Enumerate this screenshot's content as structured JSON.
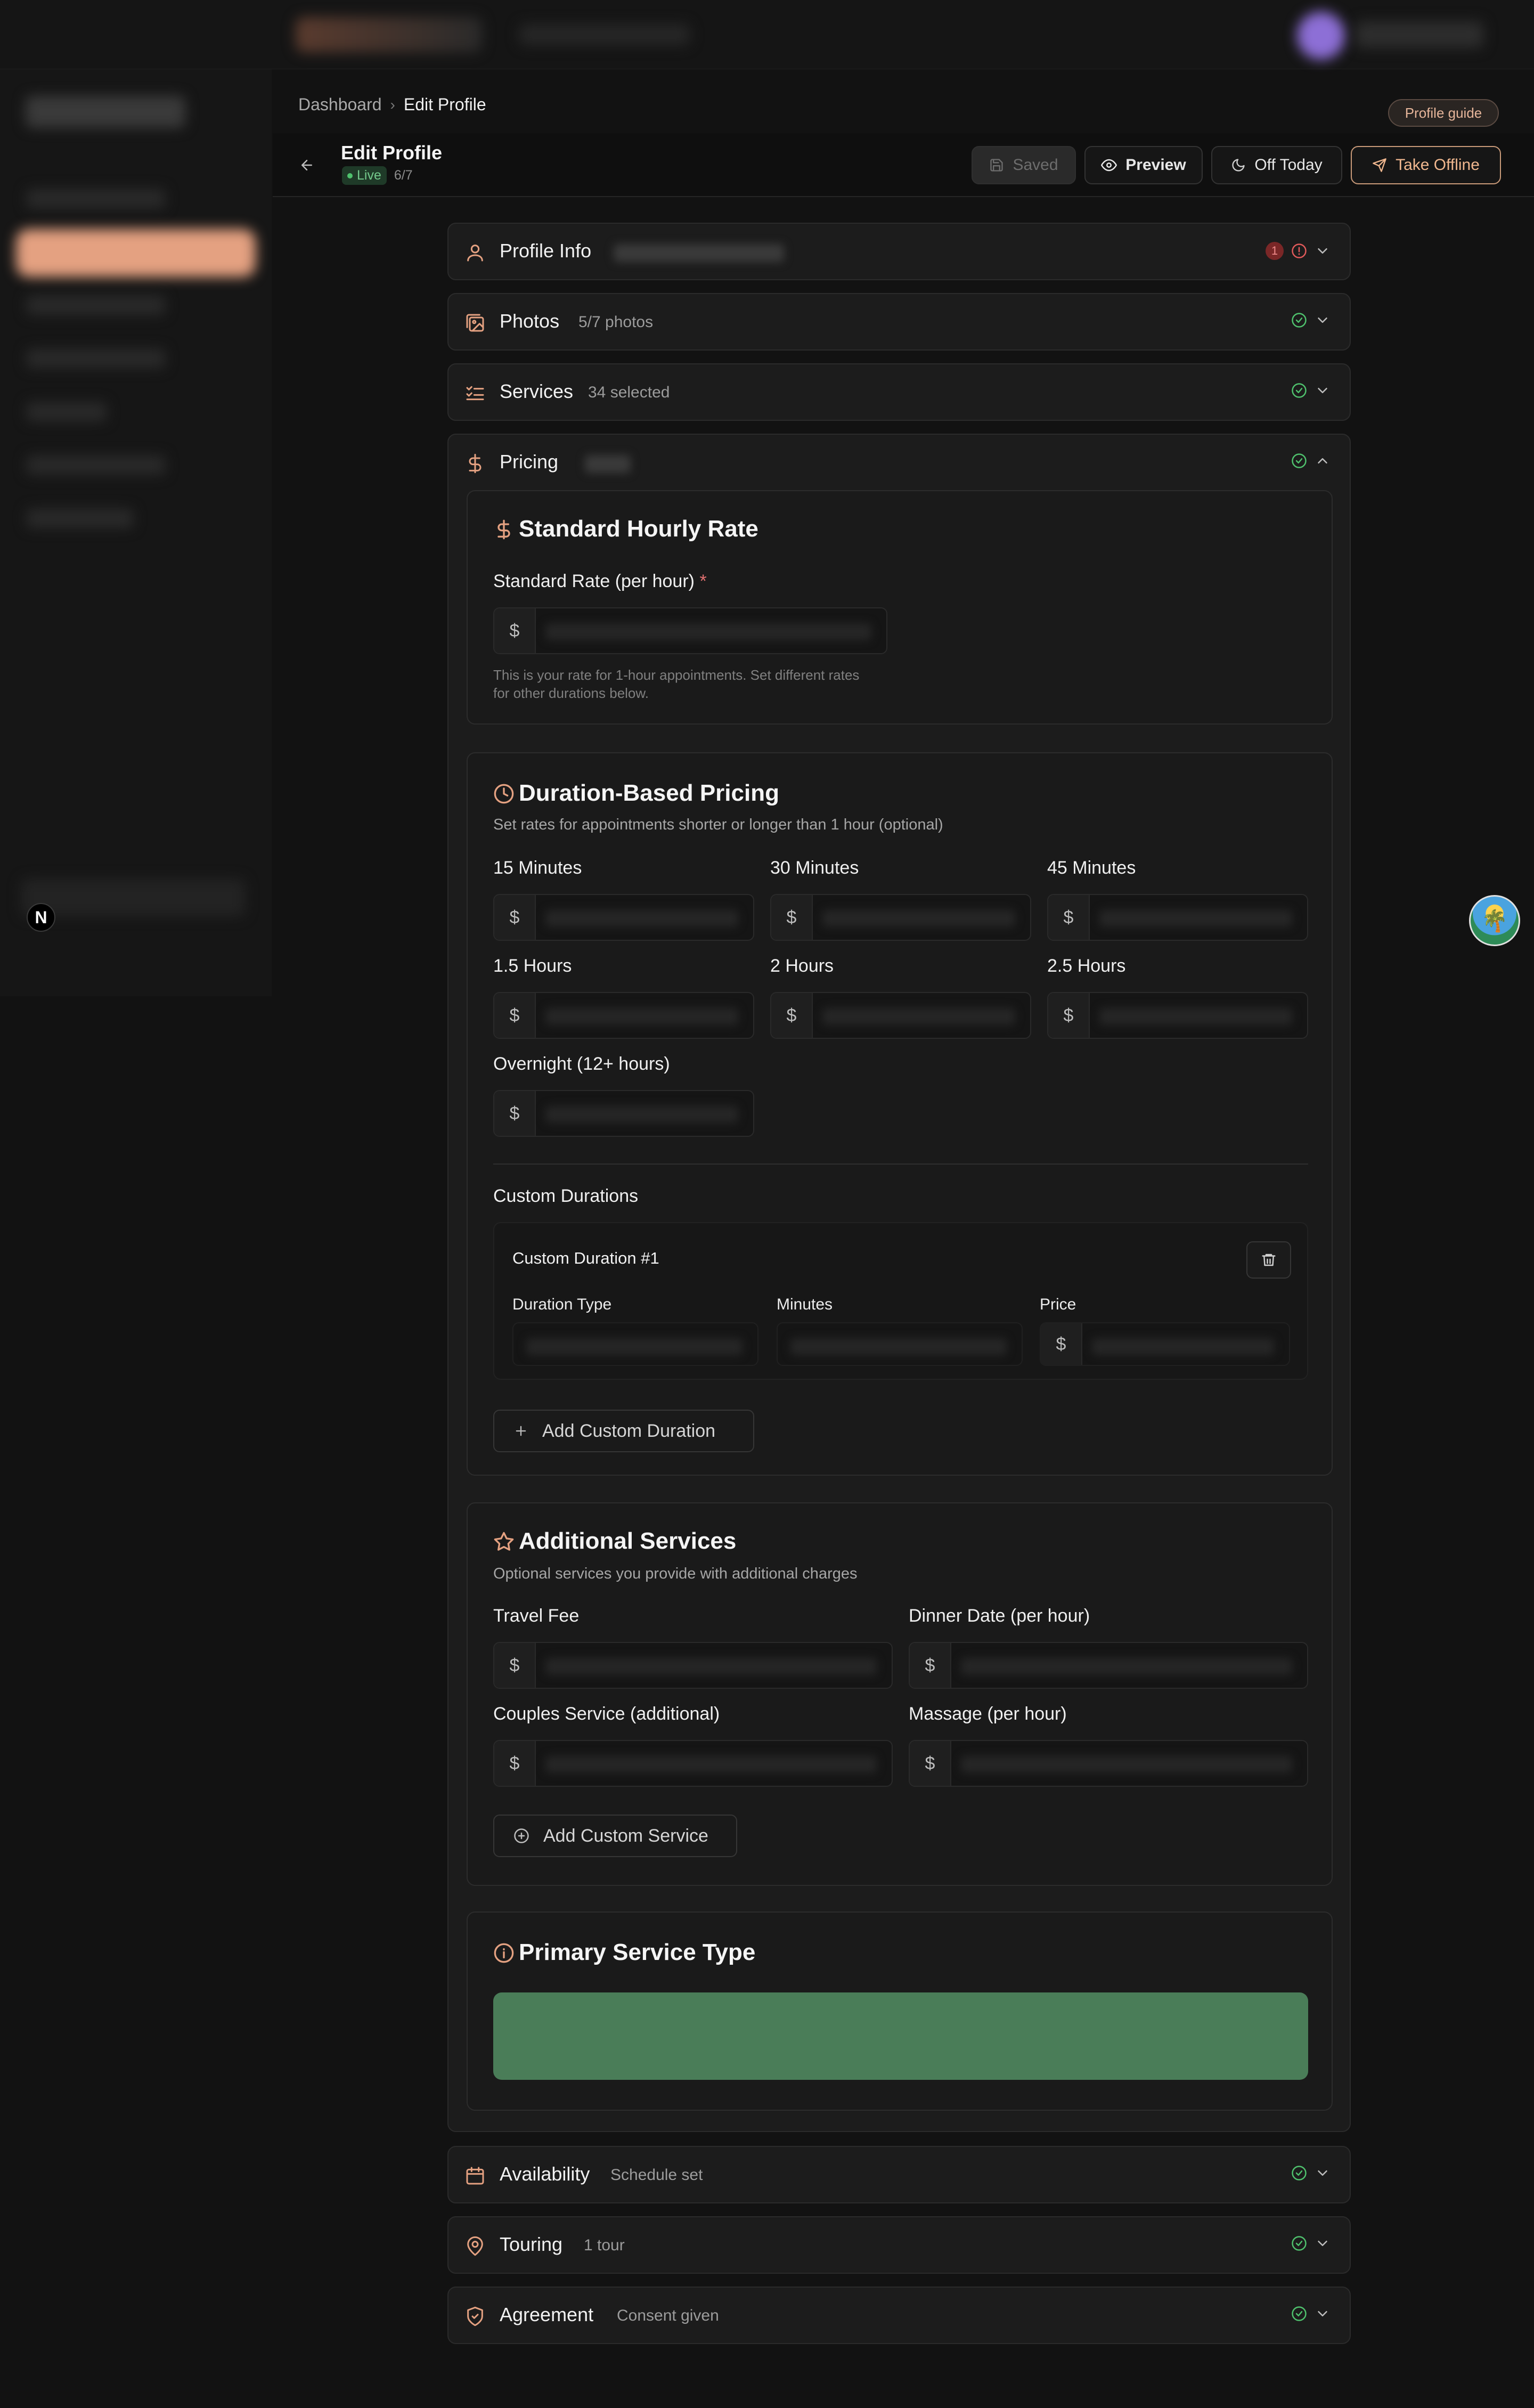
{
  "breadcrumb": {
    "parent": "Dashboard",
    "separator": "›",
    "current": "Edit Profile"
  },
  "profile_guide": "Profile guide",
  "header": {
    "title": "Edit Profile",
    "status": "Live",
    "progress": "6/7",
    "buttons": {
      "saved": "Saved",
      "preview": "Preview",
      "off_today": "Off Today",
      "take_offline": "Take Offline"
    }
  },
  "sidebar": {
    "badge": "N"
  },
  "sections": {
    "profile_info": {
      "title": "Profile Info",
      "error_count": "1"
    },
    "photos": {
      "title": "Photos",
      "summary": "5/7 photos"
    },
    "services": {
      "title": "Services",
      "summary": "34 selected"
    },
    "pricing": {
      "title": "Pricing"
    },
    "availability": {
      "title": "Availability",
      "summary": "Schedule set"
    },
    "touring": {
      "title": "Touring",
      "summary": "1 tour"
    },
    "agreement": {
      "title": "Agreement",
      "summary": "Consent given"
    }
  },
  "standard_rate": {
    "title": "Standard Hourly Rate",
    "label": "Standard Rate (per hour)",
    "required_mark": "*",
    "currency": "$",
    "hint_line1": "This is your rate for 1-hour appointments. Set different rates",
    "hint_line2": "for other durations below."
  },
  "duration_pricing": {
    "title": "Duration-Based Pricing",
    "description": "Set rates for appointments shorter or longer than 1 hour (optional)",
    "currency": "$",
    "fields": [
      "15 Minutes",
      "30 Minutes",
      "45 Minutes",
      "1.5 Hours",
      "2 Hours",
      "2.5 Hours",
      "Overnight (12+ hours)"
    ],
    "custom_heading": "Custom Durations",
    "custom_item_title": "Custom Duration #1",
    "custom_labels": {
      "type": "Duration Type",
      "minutes": "Minutes",
      "price": "Price"
    },
    "add_custom_duration": "Add Custom Duration"
  },
  "additional_services": {
    "title": "Additional Services",
    "description": "Optional services you provide with additional charges",
    "currency": "$",
    "fields": [
      "Travel Fee",
      "Dinner Date (per hour)",
      "Couples Service (additional)",
      "Massage (per hour)"
    ],
    "add_custom_service": "Add Custom Service"
  },
  "primary_service": {
    "title": "Primary Service Type"
  },
  "colors": {
    "accent": "#e4a181",
    "success": "#4fc16d",
    "error": "#e05a5a",
    "primary_service_bar": "#4a7d58"
  },
  "icons": [
    "arrow-left-icon",
    "save-icon",
    "eye-icon",
    "moon-icon",
    "send-icon",
    "user-icon",
    "images-icon",
    "checklist-icon",
    "dollar-icon",
    "clock-icon",
    "star-icon",
    "info-icon",
    "calendar-icon",
    "map-pin-icon",
    "shield-check-icon",
    "check-circle-icon",
    "chevron-down-icon",
    "chevron-up-icon",
    "trash-icon",
    "plus-icon",
    "plus-circle-icon",
    "alert-circle-icon"
  ]
}
